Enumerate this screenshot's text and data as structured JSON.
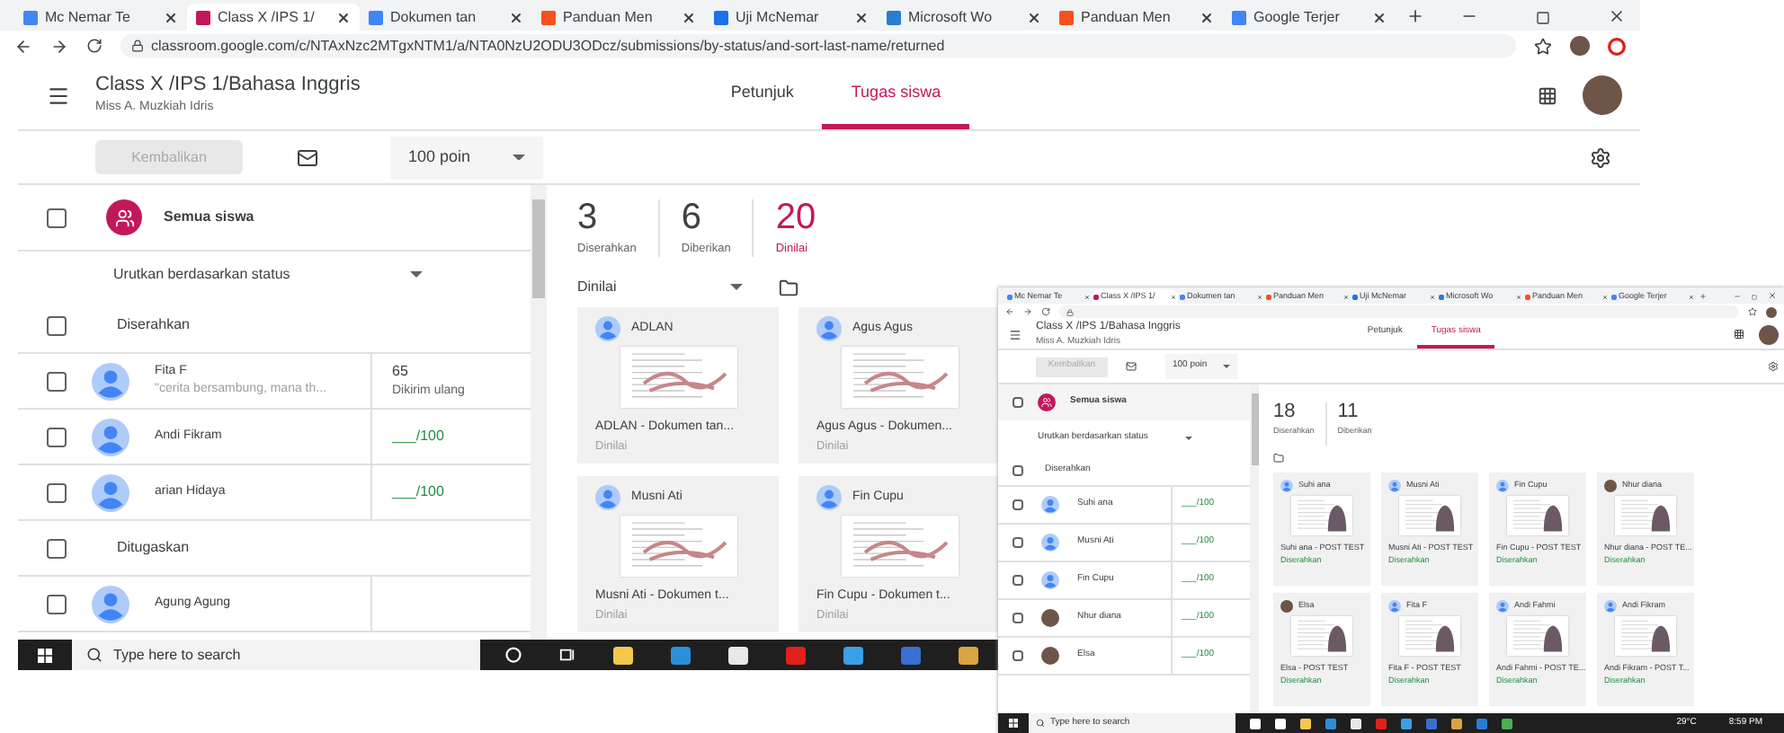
{
  "browser": {
    "tabs": [
      {
        "label": "Mc Nemar Te",
        "selected": false,
        "color": "#4285f4"
      },
      {
        "label": "Class X /IPS 1/",
        "selected": true,
        "color": "#c2185b"
      },
      {
        "label": "Dokumen tan",
        "selected": false,
        "color": "#4285f4"
      },
      {
        "label": "Panduan Men",
        "selected": false,
        "color": "#f4511e"
      },
      {
        "label": "Uji McNemar",
        "selected": false,
        "color": "#1a73e8"
      },
      {
        "label": "Microsoft Wo",
        "selected": false,
        "color": "#2b7cd3"
      },
      {
        "label": "Panduan Men",
        "selected": false,
        "color": "#f4511e"
      },
      {
        "label": "Google Terjer",
        "selected": false,
        "color": "#4285f4"
      }
    ],
    "url": "classroom.google.com/c/NTAxNzc2MTgxNTM1/a/NTA0NzU2ODU3ODcz/submissions/by-status/and-sort-last-name/returned"
  },
  "app": {
    "title": "Class X /IPS 1/Bahasa Inggris",
    "subtitle": "Miss A. Muzkiah Idris",
    "nav": [
      {
        "label": "Petunjuk",
        "selected": false
      },
      {
        "label": "Tugas siswa",
        "selected": true
      }
    ],
    "return_button": {
      "label": "Kembalikan",
      "disabled": true
    },
    "points": "100 poin"
  },
  "students_panel": {
    "all_label": "Semua siswa",
    "all_checked": false,
    "sort": "Urutkan berdasarkan status",
    "groups": [
      {
        "label": "Diserahkan",
        "checked": false,
        "students": [
          {
            "name": "Fita F",
            "note": "\"cerita bersambung, mana th...",
            "kind": "returned",
            "grade": "65",
            "grade_note": "Dikirim ulang",
            "checked": false
          },
          {
            "name": "Andi Fikram",
            "kind": "draft",
            "grade": "___/100",
            "checked": false
          },
          {
            "name": "arian Hidaya",
            "kind": "draft",
            "grade": "___/100",
            "checked": false
          }
        ]
      },
      {
        "label": "Ditugaskan",
        "checked": false,
        "students": [
          {
            "name": "Agung Agung",
            "kind": "none",
            "checked": false
          }
        ]
      }
    ]
  },
  "summary": {
    "stats": [
      {
        "value": "3",
        "label": "Diserahkan",
        "selected": false
      },
      {
        "value": "6",
        "label": "Diberikan",
        "selected": false
      },
      {
        "value": "20",
        "label": "Dinilai",
        "selected": true
      }
    ],
    "filter": "Dinilai"
  },
  "cards": [
    {
      "name": "ADLAN",
      "title": "ADLAN - Dokumen tan...",
      "status": "Dinilai"
    },
    {
      "name": "Agus Agus",
      "title": "Agus Agus - Dokumen...",
      "status": "Dinilai"
    },
    {
      "name": "Musni Ati",
      "title": "Musni Ati - Dokumen t...",
      "status": "Dinilai"
    },
    {
      "name": "Fin Cupu",
      "title": "Fin Cupu - Dokumen t...",
      "status": "Dinilai"
    }
  ],
  "taskbar": {
    "search_placeholder": "Type here to search"
  },
  "inset": {
    "tabs": [
      {
        "label": "Mc Nemar Te",
        "selected": false,
        "color": "#4285f4"
      },
      {
        "label": "Class X /IPS 1/",
        "selected": true,
        "color": "#c2185b"
      },
      {
        "label": "Dokumen tan",
        "selected": false,
        "color": "#4285f4"
      },
      {
        "label": "Panduan Men",
        "selected": false,
        "color": "#f4511e"
      },
      {
        "label": "Uji McNemar",
        "selected": false,
        "color": "#1a73e8"
      },
      {
        "label": "Microsoft Wo",
        "selected": false,
        "color": "#2b7cd3"
      },
      {
        "label": "Panduan Men",
        "selected": false,
        "color": "#f4511e"
      },
      {
        "label": "Google Terjer",
        "selected": false,
        "color": "#4285f4"
      }
    ],
    "title": "Class X /IPS 1/Bahasa Inggris",
    "subtitle": "Miss A. Muzkiah Idris",
    "nav": [
      {
        "label": "Petunjuk",
        "selected": false
      },
      {
        "label": "Tugas siswa",
        "selected": true
      }
    ],
    "return_button": "Kembalikan",
    "points": "100 poin",
    "all_label": "Semua siswa",
    "all_checked": false,
    "sort": "Urutkan berdasarkan status",
    "group": "Diserahkan",
    "group_checked": false,
    "students": [
      {
        "name": "Suhi ana",
        "kind": "default",
        "grade": "___/100",
        "checked": false
      },
      {
        "name": "Musni Ati",
        "kind": "default",
        "grade": "___/100",
        "checked": false
      },
      {
        "name": "Fin Cupu",
        "kind": "default",
        "grade": "___/100",
        "checked": false
      },
      {
        "name": "Nhur diana",
        "kind": "photo",
        "grade": "___/100",
        "checked": false
      },
      {
        "name": "Elsa",
        "kind": "photo",
        "grade": "___/100",
        "checked": false
      }
    ],
    "stats": [
      {
        "value": "18",
        "label": "Diserahkan"
      },
      {
        "value": "11",
        "label": "Diberikan"
      }
    ],
    "cards": [
      {
        "name": "Suhi ana",
        "kind": "default",
        "title": "Suhi ana - POST TEST",
        "status": "Diserahkan"
      },
      {
        "name": "Musni Ati",
        "kind": "default",
        "title": "Musni Ati - POST TEST",
        "status": "Diserahkan"
      },
      {
        "name": "Fin Cupu",
        "kind": "default",
        "title": "Fin Cupu - POST TEST",
        "status": "Diserahkan"
      },
      {
        "name": "Nhur diana",
        "kind": "photo",
        "title": "Nhur diana - POST TE...",
        "status": "Diserahkan"
      },
      {
        "name": "Elsa",
        "kind": "photo",
        "title": "Elsa - POST TEST",
        "status": "Diserahkan"
      },
      {
        "name": "Fita F",
        "kind": "default",
        "title": "Fita F - POST TEST",
        "status": "Diserahkan"
      },
      {
        "name": "Andi Fahmi",
        "kind": "default",
        "title": "Andi Fahmi - POST TE...",
        "status": "Diserahkan"
      },
      {
        "name": "Andi Fikram",
        "kind": "default",
        "title": "Andi Fikram - POST T...",
        "status": "Diserahkan"
      }
    ],
    "taskbar_search": "Type here to search",
    "weather": "29°C",
    "time": "8:59 PM"
  }
}
